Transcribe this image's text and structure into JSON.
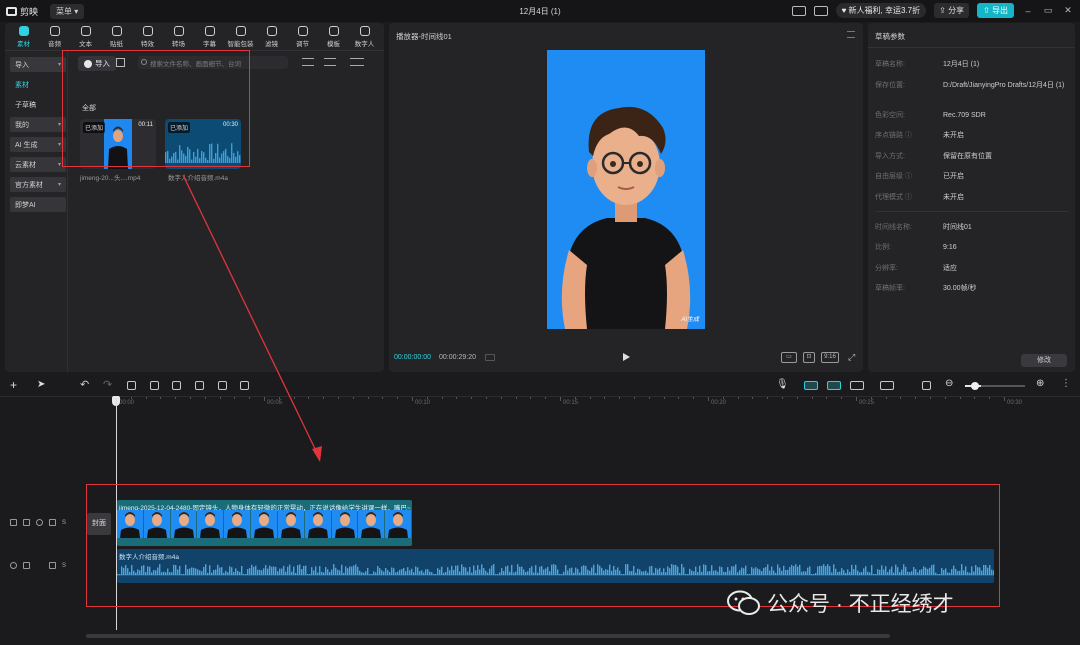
{
  "app": {
    "name": "剪映",
    "menu_label": "菜单",
    "title": "12月4日 (1)",
    "promo": "新人福利, 幸运3.7折",
    "share_label": "分享",
    "export_label": "导出"
  },
  "tool_tabs": [
    {
      "label": "素材",
      "active": true
    },
    {
      "label": "音频"
    },
    {
      "label": "文本"
    },
    {
      "label": "贴纸"
    },
    {
      "label": "特效"
    },
    {
      "label": "转场"
    },
    {
      "label": "字幕"
    },
    {
      "label": "智能包装"
    },
    {
      "label": "滤镜"
    },
    {
      "label": "调节"
    },
    {
      "label": "模板"
    },
    {
      "label": "数字人"
    }
  ],
  "sidebar": {
    "items": [
      {
        "label": "导入",
        "caret": "▾",
        "style": "sel"
      },
      {
        "label": "素材",
        "caret": "",
        "style": "plain hl"
      },
      {
        "label": "子草稿",
        "caret": "",
        "style": "plain"
      },
      {
        "label": "我的",
        "caret": "▾",
        "style": "pill"
      },
      {
        "label": "AI 生成",
        "caret": "▾",
        "style": "pill"
      },
      {
        "label": "云素材",
        "caret": "▾",
        "style": "pill"
      },
      {
        "label": "官方素材",
        "caret": "▾",
        "style": "pill"
      },
      {
        "label": "即梦AI",
        "caret": "",
        "style": "pill"
      }
    ]
  },
  "media": {
    "import_label": "导入",
    "search_placeholder": "搜索文件名称、画面细节、台词",
    "category": "全部",
    "cards": [
      {
        "badge": "已添加",
        "duration": "00:11",
        "name": "jimeng-20...头....mp4"
      },
      {
        "badge": "已添加",
        "duration": "00:30",
        "name": "数字人介绍音频.m4a"
      }
    ]
  },
  "player": {
    "title": "播放器-时间线01",
    "current_time": "00:00:00:00",
    "total_time": "00:00:29:20",
    "ratio_btn": "9:16",
    "watermark": "AI生成"
  },
  "properties": {
    "title": "草稿参数",
    "rows": [
      {
        "key": "草稿名称:",
        "value": "12月4日 (1)"
      },
      {
        "key": "保存位置:",
        "value": "D:/Draft/JianyingPro Drafts/12月4日 (1)"
      },
      {
        "key": "色彩空间:",
        "value": "Rec.709 SDR"
      },
      {
        "key": "序点链路 ⓘ",
        "value": "未开启"
      },
      {
        "key": "导入方式:",
        "value": "保留在原有位置"
      },
      {
        "key": "自由层级 ⓘ",
        "value": "已开启"
      },
      {
        "key": "代理模式 ⓘ",
        "value": "未开启"
      },
      {
        "key": "时间线名称:",
        "value": "时间线01"
      },
      {
        "key": "比例:",
        "value": "9:16"
      },
      {
        "key": "分辨率:",
        "value": "适应"
      },
      {
        "key": "草稿帧率:",
        "value": "30.00帧/秒"
      }
    ],
    "modify_label": "修改"
  },
  "timeline": {
    "ruler": [
      "00:00",
      "00:05",
      "00:10",
      "00:15",
      "00:20",
      "00:25",
      "00:30"
    ],
    "cover_label": "封面",
    "video_clip_label": "jimeng-2025-12-04-2480-固定镜头，人物身体有轻微的正常晃动，正在说话像给学生讲课一样，嘴巴~",
    "audio_clip_label": "数字人介绍音频.m4a",
    "track_s": "S"
  },
  "watermark": {
    "text": "公众号 · 不正经绣才"
  },
  "colors": {
    "accent": "#2fd3e0",
    "annotation_red": "#e0353b",
    "video_bg": "#1f8cf3"
  }
}
